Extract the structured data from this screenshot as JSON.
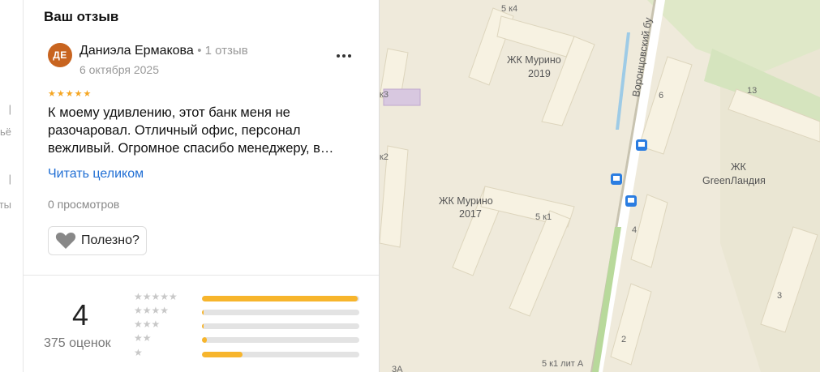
{
  "left_fragments": [
    "|",
    "ьё",
    "|",
    "ты"
  ],
  "panel": {
    "title": "Ваш отзыв"
  },
  "review": {
    "avatar_initials": "ДЕ",
    "author": "Даниэла Ермакова",
    "reviews_count": "1 отзыв",
    "date": "6 октября 2025",
    "rating": 5,
    "stars_text": "★★★★★",
    "text_lines": [
      "К моему удивлению, этот банк меня не",
      "разочаровал. Отличный офис, персонал",
      "вежливый. Огромное спасибо менеджеру, в…"
    ],
    "read_more_label": "Читать целиком",
    "views": "0 просмотров",
    "useful_label": "Полезно?"
  },
  "summary": {
    "rating": "4",
    "ratings_count": "375 оценок",
    "distribution": [
      {
        "stars": "★★★★★",
        "fraction": 0.99
      },
      {
        "stars": "★★★★",
        "fraction": 0.01
      },
      {
        "stars": "★★★",
        "fraction": 0.01
      },
      {
        "stars": "★★",
        "fraction": 0.03
      },
      {
        "stars": "★",
        "fraction": 0.26
      }
    ]
  },
  "map": {
    "labels": {
      "street": "Воронцовский бу",
      "zhk_murino_2019_name": "ЖК Мурино",
      "zhk_murino_2019_year": "2019",
      "zhk_murino_2017_name": "ЖК Мурино",
      "zhk_murino_2017_year": "2017",
      "zhk_greenlandia_1": "ЖК",
      "zhk_greenlandia_2": "GreenЛандия",
      "house_5k4": "5 к4",
      "house_5k1": "5 к1",
      "house_5k1_lit_a": "5 к1 лит А",
      "house_k3": "к3",
      "house_k2": "к2",
      "house_6": "6",
      "house_13": "13",
      "house_4": "4",
      "house_3": "3",
      "house_2": "2",
      "house_3a": "3А"
    }
  }
}
